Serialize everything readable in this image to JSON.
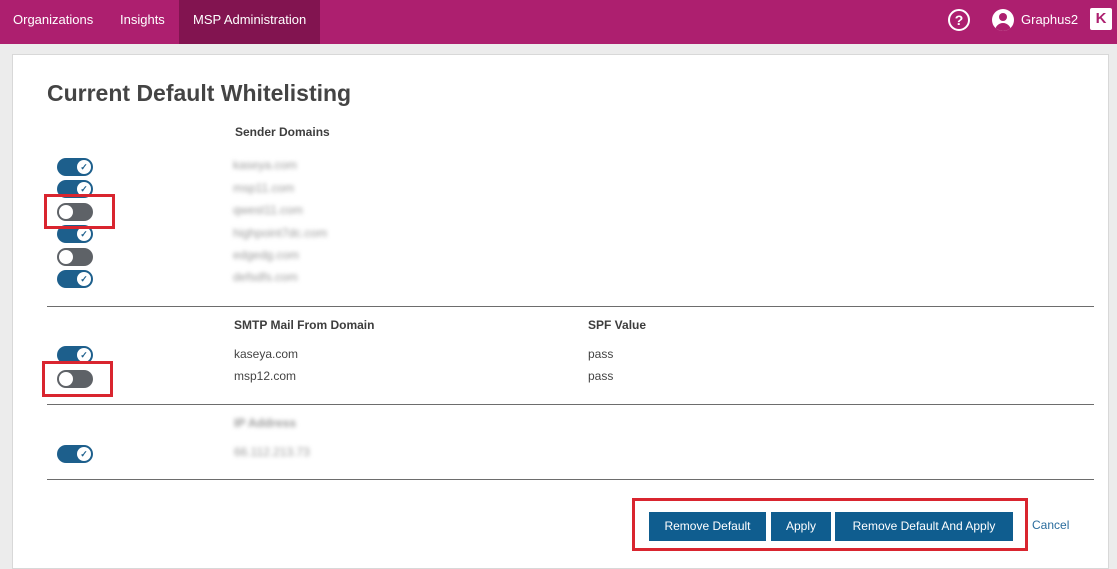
{
  "topbar": {
    "nav": [
      "Organizations",
      "Insights",
      "MSP Administration"
    ],
    "help_icon": "?",
    "user_icon": "user-circle-icon",
    "username": "Graphus2",
    "logo_glyph": "K",
    "brand_color": "#ad1f6f"
  },
  "page": {
    "title": "Current Default Whitelisting"
  },
  "sender": {
    "header": "Sender Domains",
    "rows": [
      {
        "domain": "kaseya.com",
        "enabled": true
      },
      {
        "domain": "msp11.com",
        "enabled": true
      },
      {
        "domain": "qwest11.com",
        "enabled": false
      },
      {
        "domain": "highpoint7dc.com",
        "enabled": true
      },
      {
        "domain": "edgedg.com",
        "enabled": false
      },
      {
        "domain": "defsdfs.com",
        "enabled": true
      }
    ]
  },
  "smtp": {
    "header_domain": "SMTP Mail From Domain",
    "header_spf": "SPF Value",
    "rows": [
      {
        "domain": "kaseya.com",
        "spf": "pass",
        "enabled": true
      },
      {
        "domain": "msp12.com",
        "spf": "pass",
        "enabled": false
      }
    ]
  },
  "ip": {
    "header": "IP Address",
    "rows": [
      {
        "address": "66.112.213.73",
        "enabled": true
      }
    ]
  },
  "actions": {
    "remove_default": "Remove Default",
    "apply": "Apply",
    "remove_and_apply": "Remove Default And Apply",
    "cancel": "Cancel"
  },
  "colors": {
    "toggle_on": "#1d5f8c",
    "toggle_off": "#5e6267",
    "highlight": "#d9252f",
    "button": "#0f5d8f"
  }
}
